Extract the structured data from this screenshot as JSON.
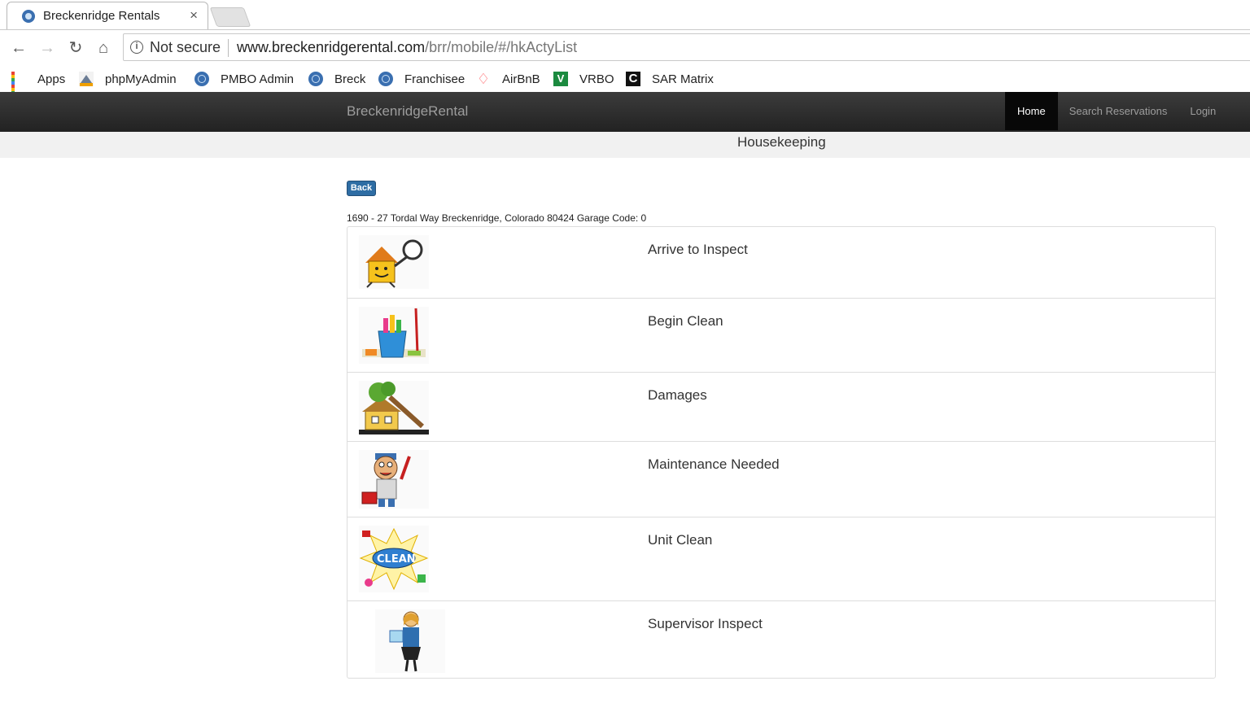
{
  "browser": {
    "tab_title": "Breckenridge Rentals",
    "tab_close": "×",
    "security_label": "Not secure",
    "url_host": "www.breckenridgerental.com",
    "url_path": "/brr/mobile/#/hkActyList"
  },
  "bookmarks": [
    {
      "label": "Apps",
      "icon": "apps-grid-icon"
    },
    {
      "label": "phpMyAdmin",
      "icon": "phpmyadmin-icon"
    },
    {
      "label": "PMBO Admin",
      "icon": "globe-icon"
    },
    {
      "label": "Breck",
      "icon": "globe-icon"
    },
    {
      "label": "Franchisee",
      "icon": "globe-icon"
    },
    {
      "label": "AirBnB",
      "icon": "airbnb-icon"
    },
    {
      "label": "VRBO",
      "icon": "vrbo-icon"
    },
    {
      "label": "SAR Matrix",
      "icon": "sar-icon"
    }
  ],
  "navbar": {
    "brand": "BreckenridgeRental",
    "links": [
      "Home",
      "Search Reservations",
      "Login"
    ],
    "active": "Home"
  },
  "page": {
    "heading": "Housekeeping",
    "back_label": "Back",
    "address": "1690 - 27 Tordal Way Breckenridge, Colorado 80424 Garage Code: 0"
  },
  "activities": [
    {
      "label": "Arrive to Inspect",
      "image": "house-inspect-image"
    },
    {
      "label": "Begin Clean",
      "image": "cleaning-bucket-image"
    },
    {
      "label": "Damages",
      "image": "fallen-tree-house-image"
    },
    {
      "label": "Maintenance Needed",
      "image": "plumber-image"
    },
    {
      "label": "Unit Clean",
      "image": "clean-burst-image"
    },
    {
      "label": "Supervisor Inspect",
      "image": "supervisor-clipboard-image"
    }
  ],
  "colors": {
    "navbar": "#222222",
    "back_button": "#2e6da4",
    "subheader": "#f1f1f1"
  }
}
